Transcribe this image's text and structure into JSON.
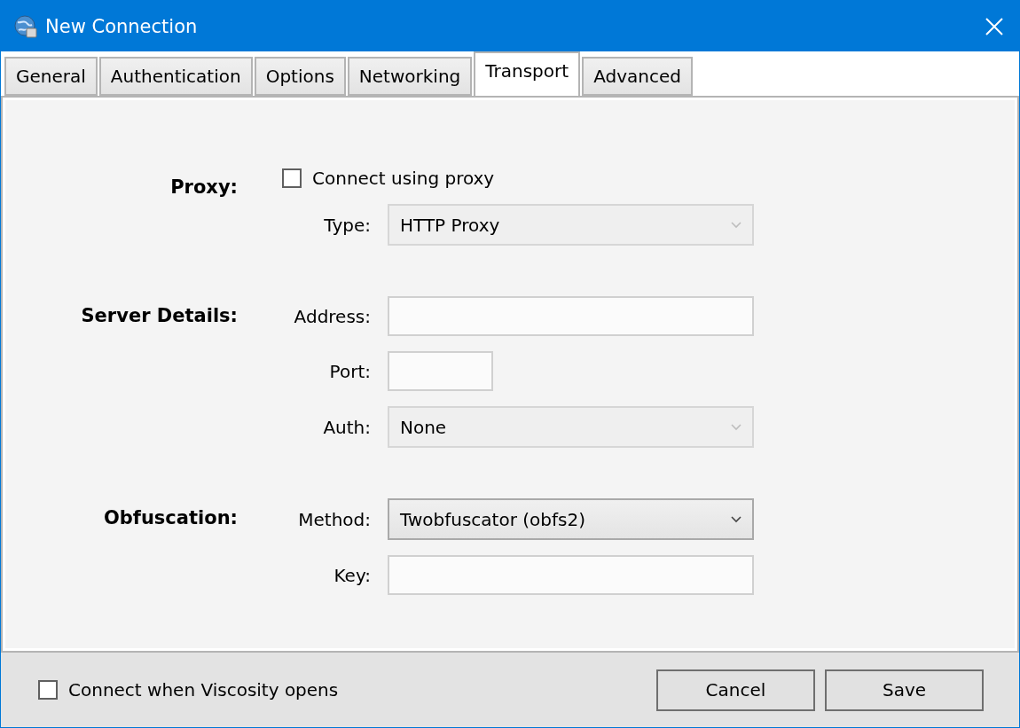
{
  "window": {
    "title": "New Connection"
  },
  "tabs": [
    {
      "label": "General",
      "selected": false
    },
    {
      "label": "Authentication",
      "selected": false
    },
    {
      "label": "Options",
      "selected": false
    },
    {
      "label": "Networking",
      "selected": false
    },
    {
      "label": "Transport",
      "selected": true
    },
    {
      "label": "Advanced",
      "selected": false
    }
  ],
  "sections": [
    {
      "label": "Proxy:",
      "rows": [
        {
          "kind": "checkbox",
          "label": "Connect using proxy",
          "checked": false
        },
        {
          "kind": "select",
          "label": "Type:",
          "value": "HTTP Proxy",
          "disabled": true
        }
      ]
    },
    {
      "label": "Server Details:",
      "rows": [
        {
          "kind": "text",
          "label": "Address:"
        },
        {
          "kind": "short",
          "label": "Port:"
        },
        {
          "kind": "select",
          "label": "Auth:",
          "value": "None",
          "disabled": true
        }
      ]
    },
    {
      "label": "Obfuscation:",
      "rows": [
        {
          "kind": "select",
          "label": "Method:",
          "value": "Twobfuscator (obfs2)",
          "disabled": false
        },
        {
          "kind": "text",
          "label": "Key:"
        }
      ]
    }
  ],
  "footer": {
    "checkbox": {
      "label": "Connect when Viscosity opens",
      "checked": false
    },
    "buttons": [
      "Cancel",
      "Save"
    ]
  }
}
